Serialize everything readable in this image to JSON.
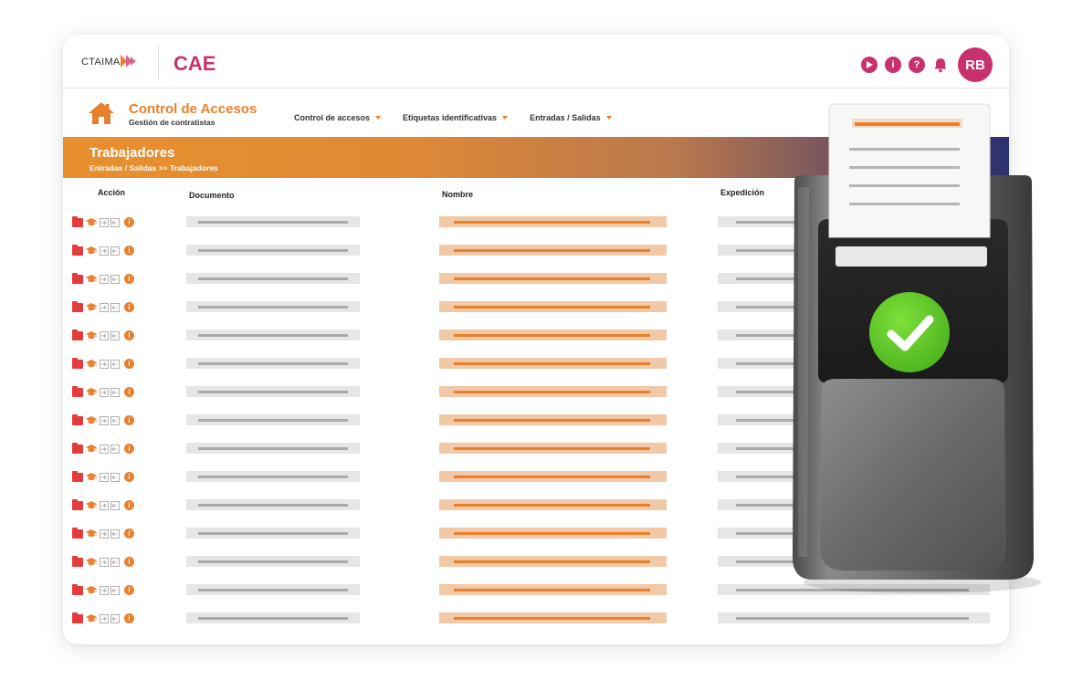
{
  "brand": {
    "company": "CTAIMA",
    "app": "CAE"
  },
  "header": {
    "icons": [
      "play-icon",
      "info-icon",
      "help-icon",
      "bell-icon"
    ],
    "avatar_initials": "RB"
  },
  "nav": {
    "title": "Control de Accesos",
    "subtitle": "Gestión de contratistas",
    "menus": [
      {
        "label": "Control de accesos"
      },
      {
        "label": "Etiquetas identificativas"
      },
      {
        "label": "Entradas / Salidas"
      }
    ]
  },
  "banner": {
    "title": "Trabajadores",
    "breadcrumb": "Entradas / Salidas >> Trabajadores"
  },
  "table": {
    "headers": {
      "action": "Acción",
      "document": "Documento",
      "name": "Nombre",
      "expedition": "Expedición"
    },
    "row_count": 15,
    "row_action_icons": [
      "folder-icon",
      "graduation-cap-icon",
      "entry-icon",
      "exit-icon",
      "info-icon"
    ]
  },
  "colors": {
    "brand": "#c8316e",
    "accent": "#e8812f",
    "folder": "#e43c3c",
    "banner_end": "#2c2f70",
    "check": "#5cc62a"
  }
}
